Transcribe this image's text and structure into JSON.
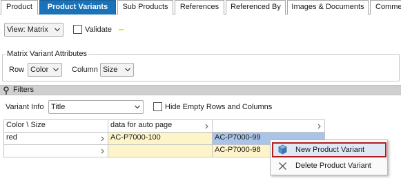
{
  "tabs": [
    {
      "label": "Product",
      "active": false
    },
    {
      "label": "Product Variants",
      "active": true
    },
    {
      "label": "Sub Products",
      "active": false
    },
    {
      "label": "References",
      "active": false
    },
    {
      "label": "Referenced By",
      "active": false
    },
    {
      "label": "Images & Documents",
      "active": false
    },
    {
      "label": "Comme",
      "active": false
    }
  ],
  "toolbar": {
    "view_value": "View: Matrix",
    "validate_label": "Validate",
    "validate_checked": false
  },
  "matrix_attributes": {
    "title": "Matrix Variant Attributes",
    "row_label": "Row",
    "row_value": "Color",
    "column_label": "Column",
    "column_value": "Size"
  },
  "filters": {
    "title": "Filters",
    "variant_info_label": "Variant Info",
    "variant_info_value": "Title",
    "hide_empty_label": "Hide Empty Rows and Columns",
    "hide_empty_checked": false
  },
  "grid": {
    "corner_header": "Color \\ Size",
    "column_headers": [
      "data for auto page",
      ""
    ],
    "rows": [
      {
        "label": "red",
        "cells": [
          "AC-P7000-100",
          "AC-P7000-99"
        ]
      },
      {
        "label": "",
        "cells": [
          "",
          "AC-P7000-98"
        ]
      }
    ]
  },
  "context_menu": {
    "items": [
      {
        "label": "New Product Variant",
        "icon": "cube-icon",
        "highlighted": true
      },
      {
        "label": "Delete Product Variant",
        "icon": "close-icon",
        "highlighted": false
      }
    ]
  },
  "colors": {
    "active_tab": "#1a73b8",
    "yellow_cell": "#fdf5c9",
    "selected_cell": "#a9c4e6",
    "highlight_border": "#b01e23",
    "validate_indicator": "#f2e600"
  }
}
